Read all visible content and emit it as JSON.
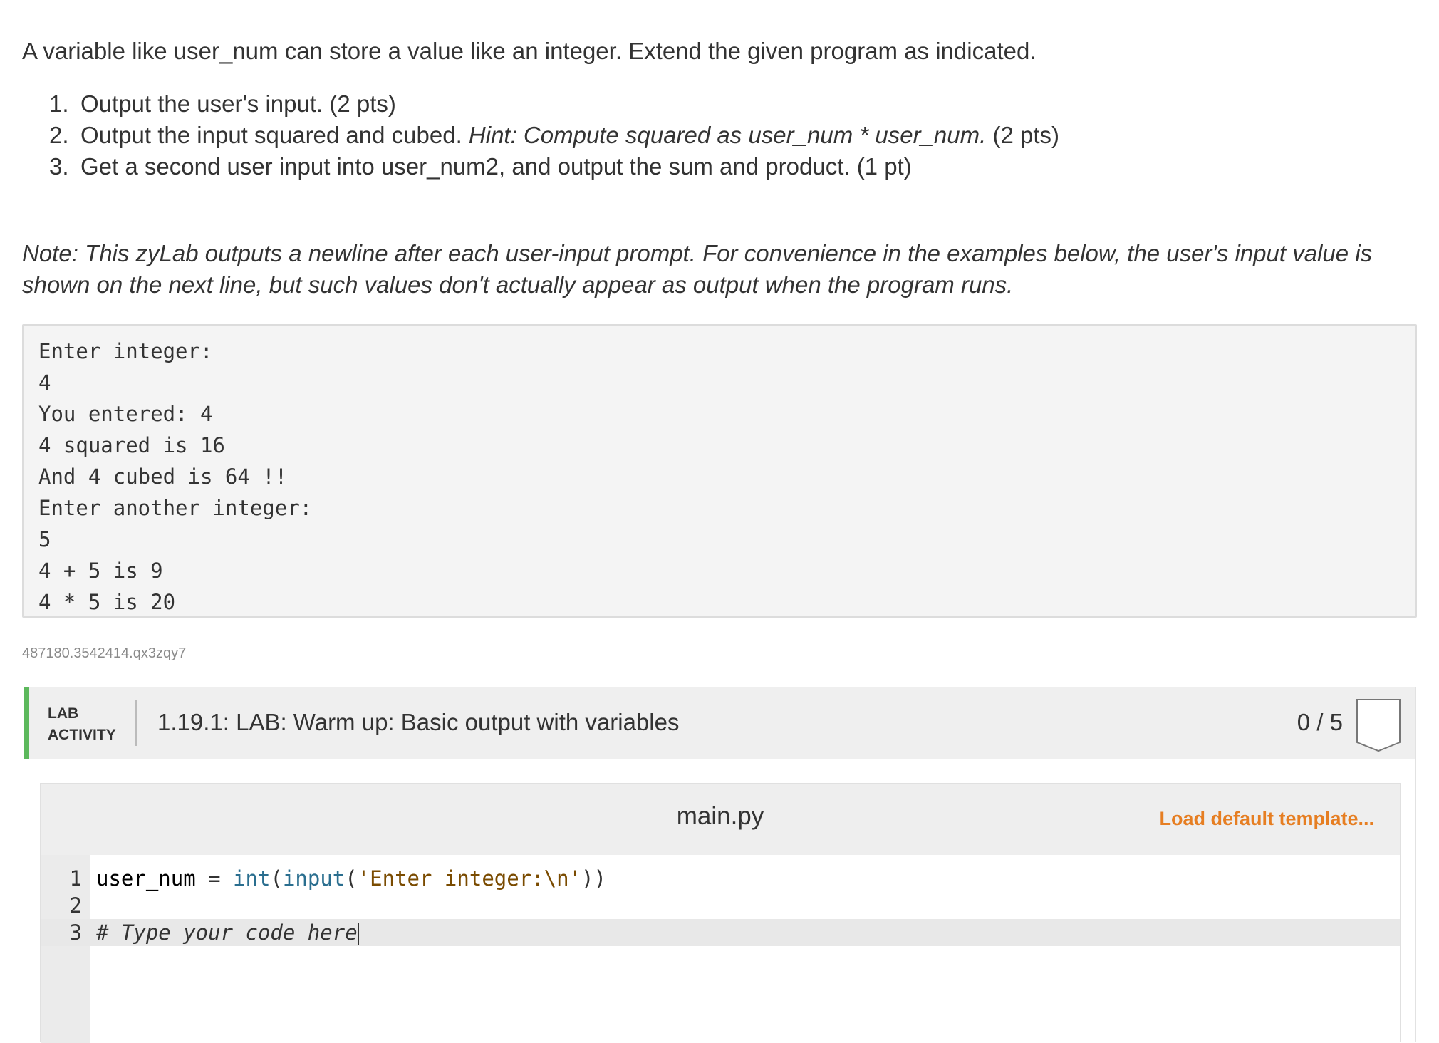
{
  "intro": "A variable like user_num can store a value like an integer. Extend the given program as indicated.",
  "steps": [
    {
      "num": "1.",
      "text": "Output the user's input. (2 pts)"
    },
    {
      "num": "2.",
      "before": "Output the input squared and cubed.",
      "hint": "Hint: Compute squared as user_num * user_num.",
      "after": "(2 pts)"
    },
    {
      "num": "3.",
      "text": "Get a second user input into user_num2, and output the sum and product. (1 pt)"
    }
  ],
  "note": "Note: This zyLab outputs a newline after each user-input prompt. For convenience in the examples below, the user's input value is shown on the next line, but such values don't actually appear as output when the program runs.",
  "example_lines": [
    "Enter integer:",
    "4",
    "You entered: 4",
    "4 squared is 16",
    "And 4 cubed is 64 !!",
    "Enter another integer:",
    "5",
    "4 + 5 is 9",
    "4 * 5 is 20"
  ],
  "lab_id": "487180.3542414.qx3zqy7",
  "lab": {
    "kind_line1": "LAB",
    "kind_line2": "ACTIVITY",
    "title": "1.19.1: LAB: Warm up: Basic output with variables",
    "score": "0 / 5"
  },
  "editor": {
    "file_name": "main.py",
    "load_template": "Load default template...",
    "line_numbers": [
      "1",
      "2",
      "3"
    ],
    "line1": {
      "var": "user_num",
      "op": " = ",
      "int": "int",
      "paren1": "(",
      "input": "input",
      "paren2": "(",
      "str": "'Enter integer:\\n'",
      "close": "))"
    },
    "line3_comment": "# Type your code here"
  },
  "colors": {
    "accent_green": "#5cb85c",
    "link_orange": "#e67e22"
  }
}
